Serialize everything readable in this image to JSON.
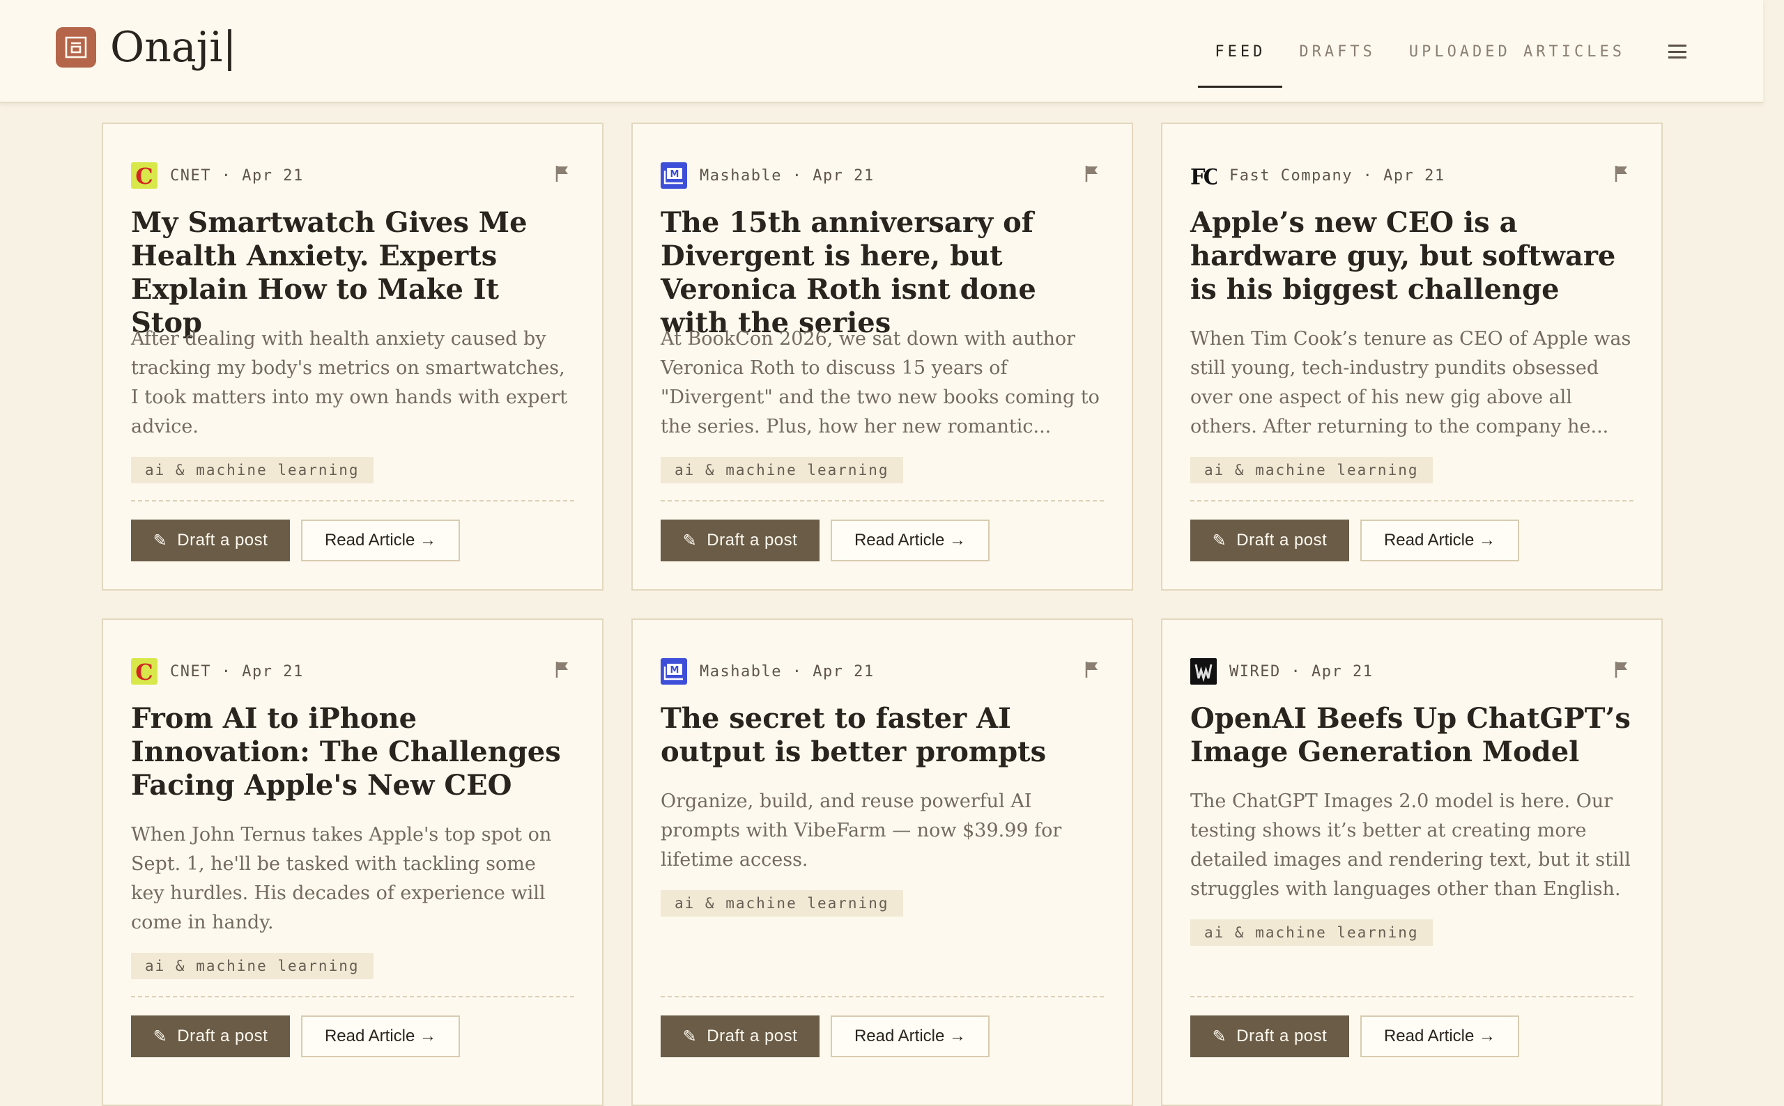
{
  "app": {
    "name": "Onaji|",
    "colors": {
      "background": "#f8f2e4",
      "card": "#fdf9ee",
      "accent": "#b4654a",
      "button": "#6b5c48",
      "tag": "#f1e9d4"
    }
  },
  "nav": {
    "items": [
      {
        "label": "FEED",
        "active": true
      },
      {
        "label": "DRAFTS",
        "active": false
      },
      {
        "label": "UPLOADED ARTICLES",
        "active": false
      }
    ],
    "menu_icon": "hamburger-menu-icon"
  },
  "cards": [
    {
      "source": "CNET",
      "source_icon": "cnet-logo-icon",
      "meta": "CNET · Apr 21",
      "title": "My Smartwatch Gives Me Health Anxiety. Experts Explain How to Make It Stop",
      "excerpt": "After dealing with health anxiety caused by tracking my body's metrics on smartwatches, I took matters into my own hands with expert advice.",
      "tag": "ai & machine learning",
      "draft_label": "Draft a post",
      "read_label": "Read Article →"
    },
    {
      "source": "Mashable",
      "source_icon": "mashable-logo-icon",
      "meta": "Mashable · Apr 21",
      "title": "The 15th anniversary of Divergent is here, but Veronica Roth isnt done with the series",
      "excerpt": "At BookCon 2026, we sat down with author Veronica Roth to discuss 15 years of \"Divergent\" and the two new books coming to the series. Plus, how her new romantic...",
      "tag": "ai & machine learning",
      "draft_label": "Draft a post",
      "read_label": "Read Article →"
    },
    {
      "source": "Fast Company",
      "source_icon": "fast-company-logo-icon",
      "meta": "Fast Company · Apr 21",
      "title": "Apple’s new CEO is a hardware guy, but software is his biggest challenge",
      "excerpt": "When Tim Cook’s tenure as CEO of Apple was still young, tech-industry pundits obsessed over one aspect of his new gig above all others. After returning to the company he...",
      "tag": "ai & machine learning",
      "draft_label": "Draft a post",
      "read_label": "Read Article →"
    },
    {
      "source": "CNET",
      "source_icon": "cnet-logo-icon",
      "meta": "CNET · Apr 21",
      "title": "From AI to iPhone Innovation: The Challenges Facing Apple's New CEO",
      "excerpt": "When John Ternus takes Apple's top spot on Sept. 1, he'll be tasked with tackling some key hurdles. His decades of experience will come in handy.",
      "tag": "ai & machine learning",
      "draft_label": "Draft a post",
      "read_label": "Read Article →"
    },
    {
      "source": "Mashable",
      "source_icon": "mashable-logo-icon",
      "meta": "Mashable · Apr 21",
      "title": "The secret to faster AI output is better prompts",
      "excerpt": "Organize, build, and reuse powerful AI prompts with VibeFarm — now $39.99 for lifetime access.",
      "tag": "ai & machine learning",
      "draft_label": "Draft a post",
      "read_label": "Read Article →"
    },
    {
      "source": "WIRED",
      "source_icon": "wired-logo-icon",
      "meta": "WIRED · Apr 21",
      "title": "OpenAI Beefs Up ChatGPT’s Image Generation Model",
      "excerpt": "The ChatGPT Images 2.0 model is here. Our testing shows it’s better at creating more detailed images and rendering text, but it still struggles with languages other than English.",
      "tag": "ai & machine learning",
      "draft_label": "Draft a post",
      "read_label": "Read Article →"
    }
  ]
}
